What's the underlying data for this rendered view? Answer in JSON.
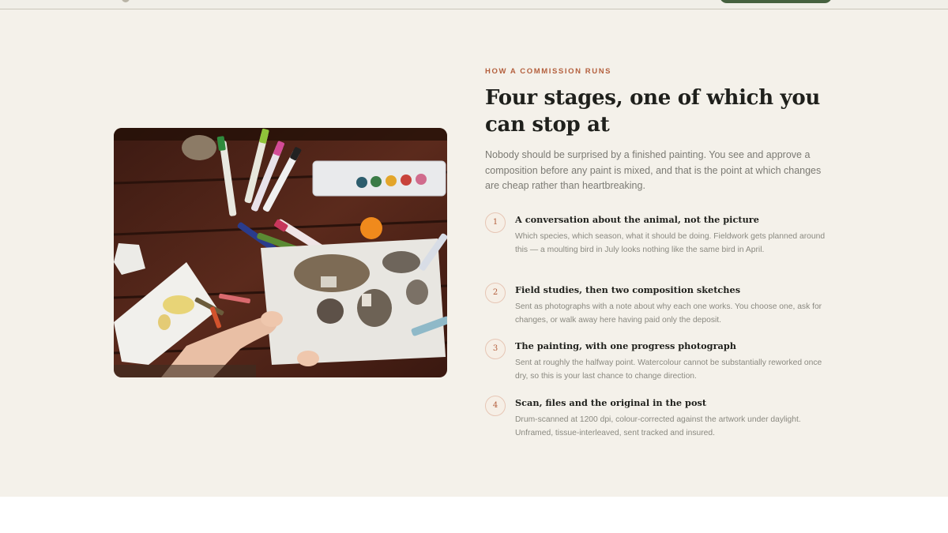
{
  "section": {
    "eyebrow": "HOW A COMMISSION RUNS",
    "heading": "Four stages, one of which you can stop at",
    "intro": "Nobody should be surprised by a finished painting. You see and approve a composition before any paint is mixed, and that is the point at which changes are cheap rather than heartbreaking.",
    "steps": [
      {
        "number": "1",
        "title": "A conversation about the animal, not the picture",
        "description": "Which species, which season, what it should be doing. Fieldwork gets planned around this — a moulting bird in July looks nothing like the same bird in April."
      },
      {
        "number": "2",
        "title": "Field studies, then two composition sketches",
        "description": "Sent as photographs with a note about why each one works. You choose one, ask for changes, or walk away here having paid only the deposit."
      },
      {
        "number": "3",
        "title": "The painting, with one progress photograph",
        "description": "Sent at roughly the halfway point. Watercolour cannot be substantially reworked once dry, so this is your last chance to change direction."
      },
      {
        "number": "4",
        "title": "Scan, files and the original in the post",
        "description": "Drum-scanned at 1200 dpi, colour-corrected against the artwork under daylight. Unframed, tissue-interleaved, sent tracked and insured."
      }
    ]
  },
  "colors": {
    "accent": "#b4603e",
    "brand_green": "#46613f",
    "section_bg": "#f4f1ea",
    "heading": "#1f201c",
    "body_text": "#7b7a73"
  }
}
